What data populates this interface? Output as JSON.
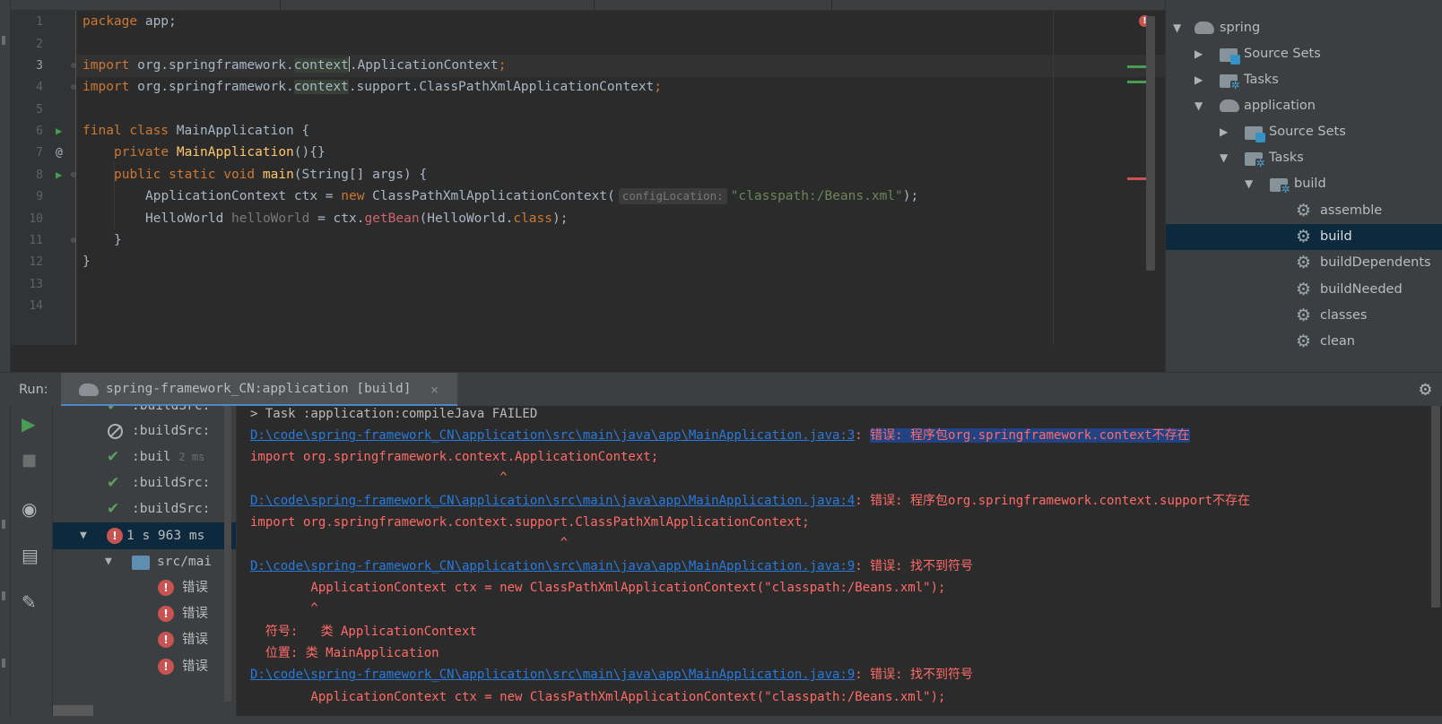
{
  "editor": {
    "lines": [
      {
        "num": "1"
      },
      {
        "num": "2"
      },
      {
        "num": "3"
      },
      {
        "num": "4"
      },
      {
        "num": "5"
      },
      {
        "num": "6"
      },
      {
        "num": "7"
      },
      {
        "num": "8"
      },
      {
        "num": "9"
      },
      {
        "num": "10"
      },
      {
        "num": "11"
      },
      {
        "num": "12"
      },
      {
        "num": "13"
      },
      {
        "num": "14"
      }
    ],
    "code": {
      "l1_kw": "package",
      "l1_rest": " app;",
      "l3_kw": "import",
      "l3_a": " org.springframework.",
      "l3_hl": "context",
      "l3_b": ".ApplicationContext",
      "l3_semi": ";",
      "l4_kw": "import",
      "l4_a": " org.springframework.",
      "l4_hl": "context",
      "l4_b": ".support.ClassPathXmlApplicationContext",
      "l4_semi": ";",
      "l6_kw": "final class",
      "l6_rest": " MainApplication {",
      "l7_kw": "private",
      "l7_fn": "MainApplication",
      "l7_rest": "(){}",
      "l8_kw": "public static void",
      "l8_fn": "main",
      "l8_rest": "(String[] args) {",
      "l9_a": "ApplicationContext ctx = ",
      "l9_kw": "new",
      "l9_b": " ClassPathXmlApplicationContext(",
      "l9_hint": "configLocation:",
      "l9_str": "\"classpath:/Beans.xml\"",
      "l9_end": ");",
      "l10_a": "HelloWorld ",
      "l10_var": "helloWorld",
      "l10_b": " = ctx.",
      "l10_method": "getBean",
      "l10_c": "(HelloWorld.",
      "l10_kw": "class",
      "l10_end": ");",
      "l11": "}",
      "l12": "}"
    },
    "error_count_icon": "!"
  },
  "gradle": {
    "items": [
      {
        "label": "spring",
        "icon": "elephant-icon"
      },
      {
        "label": "Source Sets",
        "icon": "source-sets-icon"
      },
      {
        "label": "Tasks",
        "icon": "tasks-folder-icon"
      },
      {
        "label": "application",
        "icon": "elephant-icon"
      },
      {
        "label": "Source Sets",
        "icon": "source-sets-icon"
      },
      {
        "label": "Tasks",
        "icon": "tasks-folder-icon"
      },
      {
        "label": "build",
        "icon": "tasks-folder-icon"
      },
      {
        "label": "assemble",
        "icon": "gear-icon"
      },
      {
        "label": "build",
        "icon": "gear-icon"
      },
      {
        "label": "buildDependents",
        "icon": "gear-icon"
      },
      {
        "label": "buildNeeded",
        "icon": "gear-icon"
      },
      {
        "label": "classes",
        "icon": "gear-icon"
      },
      {
        "label": "clean",
        "icon": "gear-icon"
      }
    ]
  },
  "run": {
    "label": "Run:",
    "tab_label": "spring-framework_CN:application [build]",
    "tab_close": "×",
    "tree": [
      {
        "label": ":buildSrc:",
        "status": "success"
      },
      {
        "label": ":buildSrc:",
        "status": "cancelled"
      },
      {
        "label": ":buil",
        "duration": "2 ms",
        "status": "success"
      },
      {
        "label": ":buildSrc:",
        "status": "success"
      },
      {
        "label": ":buildSrc:",
        "status": "success"
      },
      {
        "label": "1 s 963 ms",
        "status": "error"
      },
      {
        "label": "src/mai",
        "status": "file"
      },
      {
        "label": "错误",
        "status": "error"
      },
      {
        "label": "错误",
        "status": "error"
      },
      {
        "label": "错误",
        "status": "error"
      },
      {
        "label": "错误",
        "status": "error"
      }
    ]
  },
  "console": {
    "task_line": "> Task :application:compileJava FAILED",
    "e1_link": "D:\\code\\spring-framework_CN\\application\\src\\main\\java\\app\\MainApplication.java:3",
    "e1_sep": ": ",
    "e1_msg": "错误: 程序包org.springframework.context不存在",
    "e1_code": "import org.springframework.context.ApplicationContext;",
    "e1_caret": "                                 ^",
    "e2_link": "D:\\code\\spring-framework_CN\\application\\src\\main\\java\\app\\MainApplication.java:4",
    "e2_msg": ": 错误: 程序包org.springframework.context.support不存在",
    "e2_code": "import org.springframework.context.support.ClassPathXmlApplicationContext;",
    "e2_caret": "                                         ^",
    "e3_link": "D:\\code\\spring-framework_CN\\application\\src\\main\\java\\app\\MainApplication.java:9",
    "e3_msg": ": 错误: 找不到符号",
    "e3_code": "        ApplicationContext ctx = new ClassPathXmlApplicationContext(\"classpath:/Beans.xml\");",
    "e3_caret": "        ^",
    "e3_sym": "  符号:   类 ApplicationContext",
    "e3_loc": "  位置: 类 MainApplication",
    "e4_link": "D:\\code\\spring-framework_CN\\application\\src\\main\\java\\app\\MainApplication.java:9",
    "e4_msg": ": 错误: 找不到符号",
    "e4_code": "        ApplicationContext ctx = new ClassPathXmlApplicationContext(\"classpath:/Beans.xml\");"
  },
  "colors": {
    "editor_bg": "#2b2b2b",
    "panel_bg": "#3c3f41",
    "keyword": "#cc7832",
    "function": "#ffc66d",
    "string": "#6a8759",
    "error": "#ff6b68",
    "link": "#287bde",
    "selection": "#0d293e"
  }
}
